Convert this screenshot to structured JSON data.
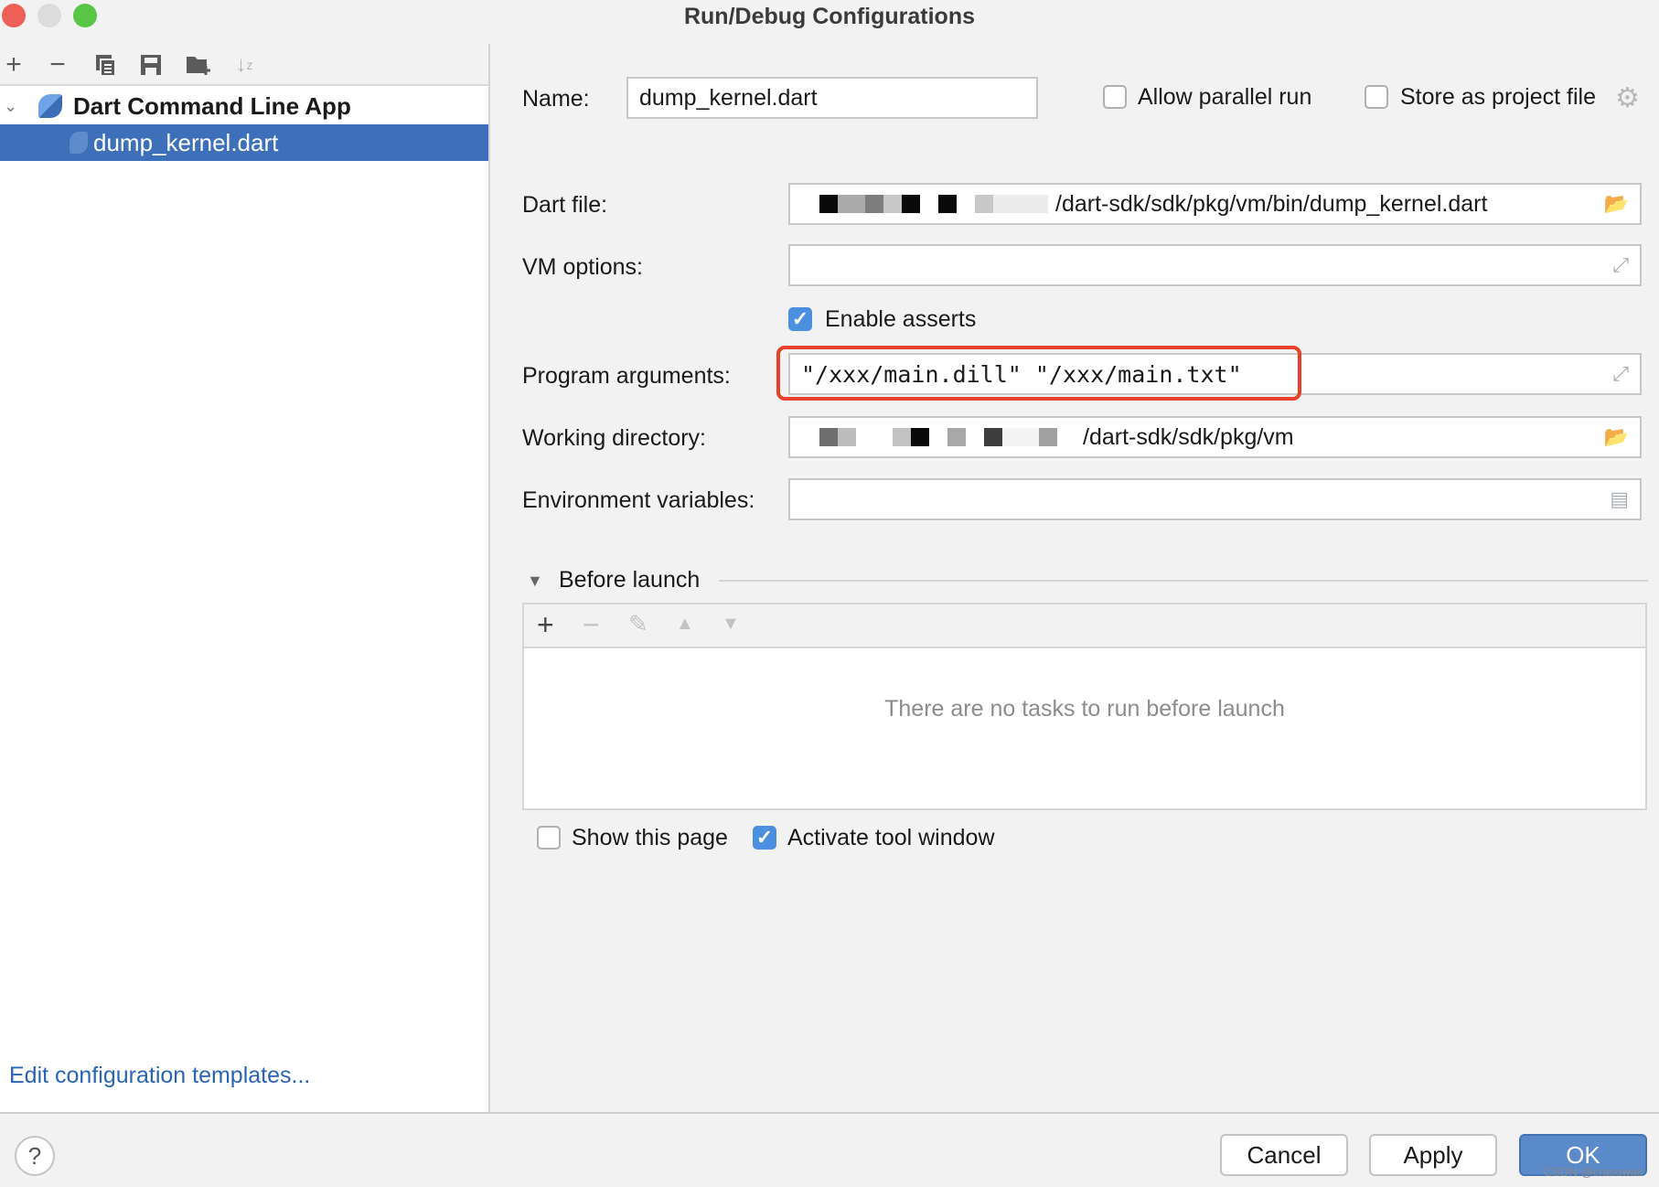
{
  "window": {
    "title": "Run/Debug Configurations",
    "traffic_lights": {
      "close": "#ee5f57",
      "minimize": "#dcdcdc",
      "zoom": "#58c544"
    }
  },
  "left_toolbar": {
    "icons": [
      "add-icon",
      "remove-icon",
      "copy-icon",
      "save-icon",
      "new-folder-icon",
      "sort-icon"
    ],
    "glyphs": {
      "add": "+",
      "remove": "−",
      "sort": "↓ᵃ"
    }
  },
  "tree": {
    "group": {
      "label": "Dart Command Line App",
      "expanded": true
    },
    "items": [
      {
        "label": "dump_kernel.dart",
        "selected": true
      }
    ]
  },
  "edit_templates_link": "Edit configuration templates...",
  "form": {
    "name_label": "Name:",
    "name_value": "dump_kernel.dart",
    "allow_parallel_label": "Allow parallel run",
    "allow_parallel_checked": false,
    "store_project_label": "Store as project file",
    "store_project_checked": false,
    "dart_file_label": "Dart file:",
    "dart_file_value": "/dart-sdk/sdk/pkg/vm/bin/dump_kernel.dart",
    "vm_options_label": "VM options:",
    "vm_options_value": "",
    "enable_asserts_label": "Enable asserts",
    "enable_asserts_checked": true,
    "program_args_label": "Program arguments:",
    "program_args_value": "\"/xxx/main.dill\" \"/xxx/main.txt\"",
    "working_dir_label": "Working directory:",
    "working_dir_value": "/dart-sdk/sdk/pkg/vm",
    "env_vars_label": "Environment variables:",
    "env_vars_value": ""
  },
  "before_launch": {
    "title": "Before launch",
    "empty_text": "There are no tasks to run before launch",
    "toolbar": [
      "add-icon",
      "remove-icon",
      "edit-icon",
      "move-up-icon",
      "move-down-icon"
    ]
  },
  "options": {
    "show_page_label": "Show this page",
    "show_page_checked": false,
    "activate_tool_label": "Activate tool window",
    "activate_tool_checked": true
  },
  "buttons": {
    "help": "?",
    "cancel": "Cancel",
    "apply": "Apply",
    "ok": "OK"
  },
  "highlight_color": "#e5412d",
  "watermark": "CSDN @crasowas"
}
